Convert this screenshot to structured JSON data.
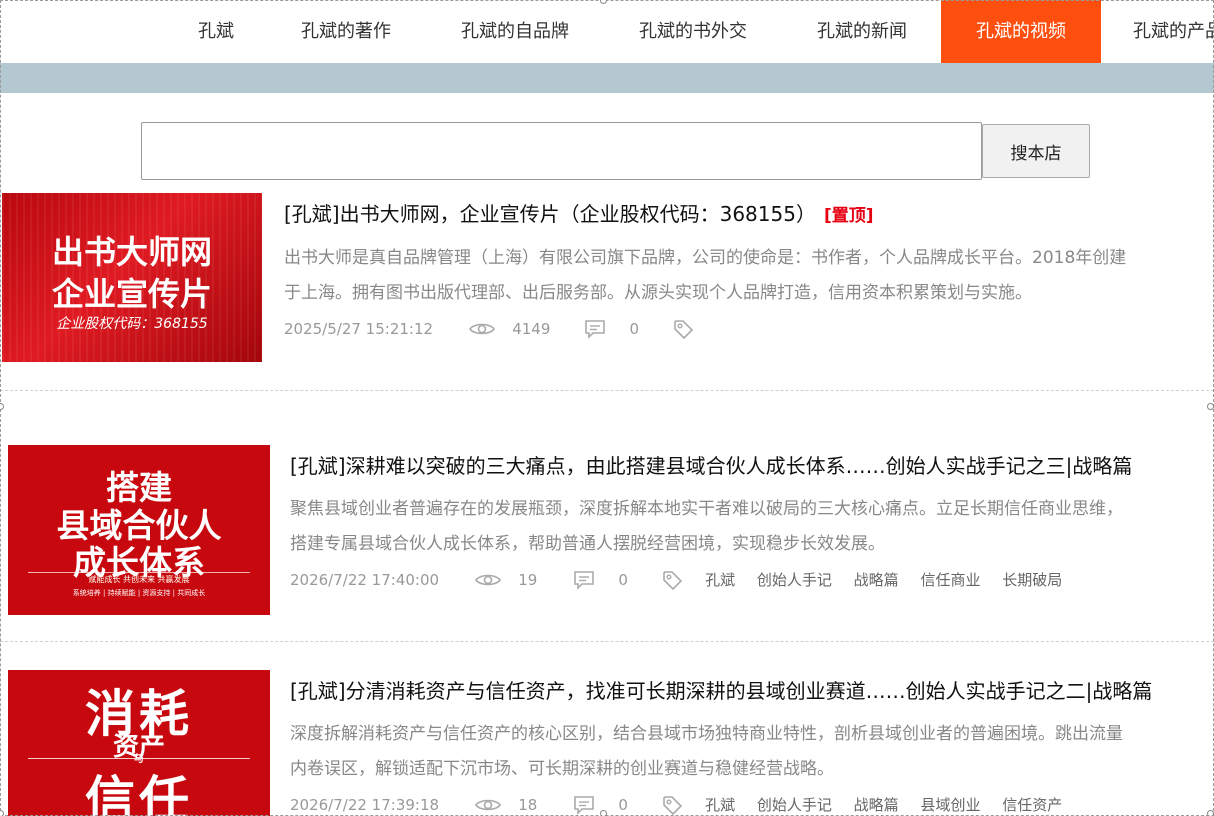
{
  "nav": {
    "items": [
      {
        "label": "孔斌"
      },
      {
        "label": "孔斌的著作"
      },
      {
        "label": "孔斌的自品牌"
      },
      {
        "label": "孔斌的书外交"
      },
      {
        "label": "孔斌的新闻"
      },
      {
        "label": "孔斌的视频"
      },
      {
        "label": "孔斌的产品"
      }
    ],
    "active_index": 5
  },
  "search": {
    "placeholder": "",
    "value": "",
    "button_label": "搜本店"
  },
  "colors": {
    "accent": "#ff4f0f",
    "band": "#b3c8d0",
    "pin": "#e60012",
    "thumb_red": "#c8080f"
  },
  "posts": [
    {
      "thumb": {
        "line1": "出书大师网",
        "line2": "企业宣传片",
        "line3": "企业股权代码：368155"
      },
      "title": "[孔斌]出书大师网，企业宣传片（企业股权代码：368155）",
      "pinned_label": "[置顶]",
      "desc_line1": "出书大师是真自品牌管理（上海）有限公司旗下品牌，公司的使命是：书作者，个人品牌成长平台。2018年创建",
      "desc_line2": "于上海。拥有图书出版代理部、出后服务部。从源头实现个人品牌打造，信用资本积累策划与实施。",
      "date": "2025/5/27 15:21:12",
      "views": "4149",
      "comments": "0",
      "tags": []
    },
    {
      "thumb": {
        "line1": "搭建",
        "line2": "县域合伙人",
        "line3": "成长体系",
        "line4": "赋能成长  共创未来  共赢发展",
        "line5": "系统培养 | 持续赋能 | 资源支持 | 共同成长"
      },
      "title": "[孔斌]深耕难以突破的三大痛点，由此搭建县域合伙人成长体系……创始人实战手记之三|战略篇",
      "desc_line1": "聚焦县域创业者普遍存在的发展瓶颈，深度拆解本地实干者难以破局的三大核心痛点。立足长期信任商业思维，",
      "desc_line2": "搭建专属县域合伙人成长体系，帮助普通人摆脱经营困境，实现稳步长效发展。",
      "date": "2026/7/22 17:40:00",
      "views": "19",
      "comments": "0",
      "tags": [
        "孔斌",
        "创始人手记",
        "战略篇",
        "信任商业",
        "长期破局"
      ]
    },
    {
      "thumb": {
        "line1": "消耗",
        "line2": "资产",
        "line3": "与",
        "line4": "信任"
      },
      "title": "[孔斌]分清消耗资产与信任资产，找准可长期深耕的县域创业赛道……创始人实战手记之二|战略篇",
      "desc_line1": "深度拆解消耗资产与信任资产的核心区别，结合县域市场独特商业特性，剖析县域创业者的普遍困境。跳出流量",
      "desc_line2": "内卷误区，解锁适配下沉市场、可长期深耕的创业赛道与稳健经营战略。",
      "date": "2026/7/22 17:39:18",
      "views": "18",
      "comments": "0",
      "tags": [
        "孔斌",
        "创始人手记",
        "战略篇",
        "县域创业",
        "信任资产"
      ]
    }
  ]
}
